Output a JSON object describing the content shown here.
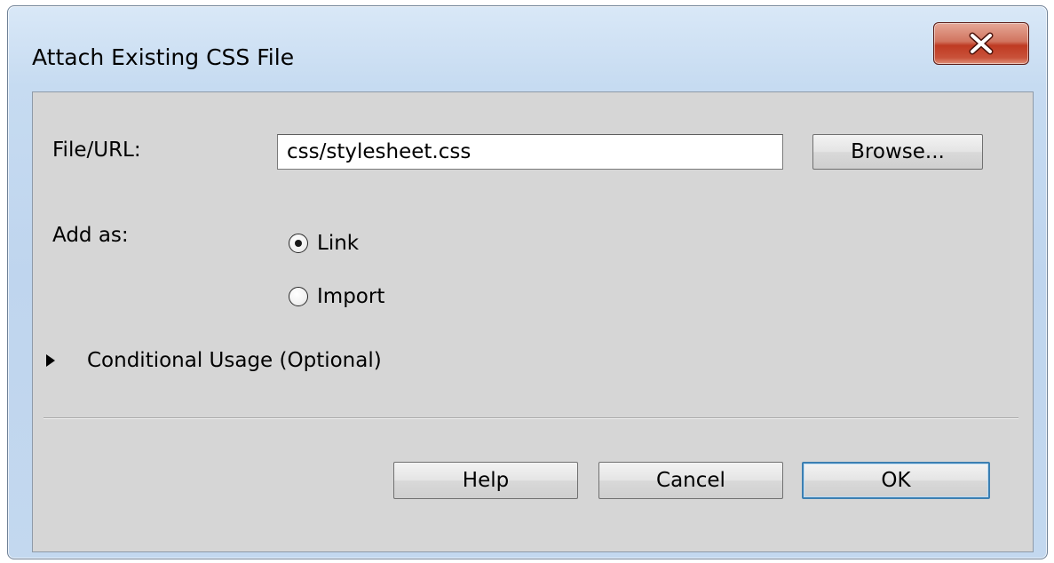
{
  "window": {
    "title": "Attach Existing CSS File",
    "close_icon": "close-x-icon"
  },
  "form": {
    "file_url_label": "File/URL:",
    "file_url_value": "css/stylesheet.css",
    "browse_label": "Browse...",
    "add_as_label": "Add as:",
    "options": [
      {
        "label": "Link",
        "selected": true
      },
      {
        "label": "Import",
        "selected": false
      }
    ],
    "conditional_label": "Conditional Usage (Optional)",
    "conditional_expanded": false
  },
  "buttons": {
    "help": "Help",
    "cancel": "Cancel",
    "ok": "OK"
  },
  "colors": {
    "close_button": "#c9523a",
    "client_background": "#d6d6d6",
    "default_button_border": "#3c7fb1"
  }
}
